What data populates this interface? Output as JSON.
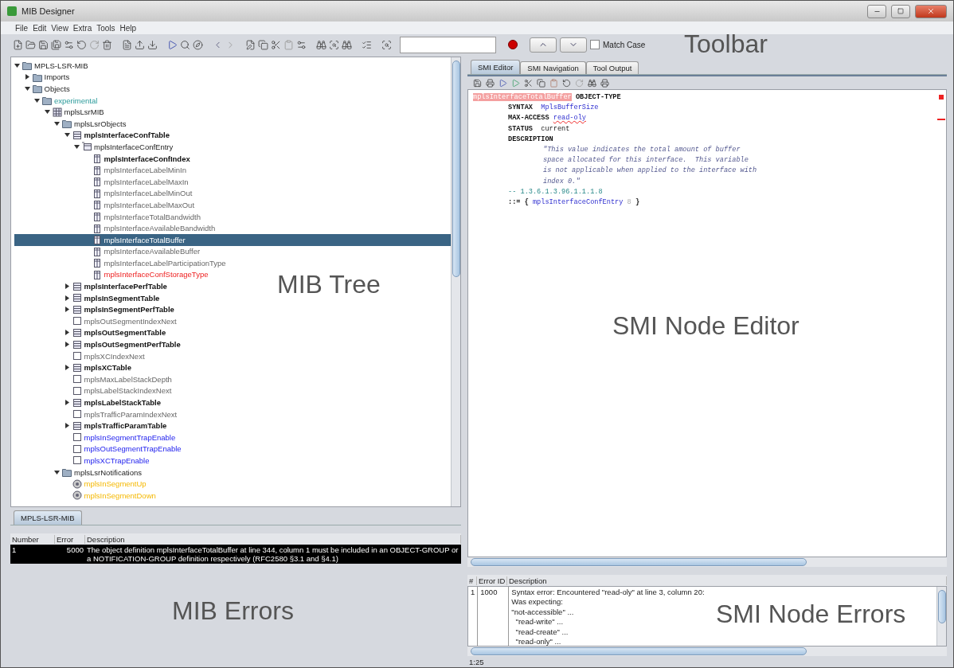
{
  "window": {
    "title": "MIB Designer"
  },
  "menu": [
    "File",
    "Edit",
    "View",
    "Extra",
    "Tools",
    "Help"
  ],
  "toolbar": {
    "match_case": {
      "label": "Match Case",
      "checked": false
    }
  },
  "tree": {
    "nodes": [
      {
        "label": "MPLS-LSR-MIB",
        "kind": "folder",
        "expanded": true,
        "selected": false,
        "children": [
          {
            "label": "Imports",
            "kind": "folder",
            "expanded": false,
            "selected": false
          },
          {
            "label": "Objects",
            "kind": "folder",
            "expanded": true,
            "selected": false,
            "children": [
              {
                "label": "experimental",
                "kind": "branch",
                "expanded": true,
                "selected": false,
                "children": [
                  {
                    "label": "mplsLsrMIB",
                    "kind": "module",
                    "expanded": true,
                    "selected": false,
                    "children": [
                      {
                        "label": "mplsLsrObjects",
                        "kind": "folder",
                        "expanded": true,
                        "selected": false,
                        "children": [
                          {
                            "label": "mplsInterfaceConfTable",
                            "kind": "table",
                            "expanded": true,
                            "selected": false,
                            "children": [
                              {
                                "label": "mplsInterfaceConfEntry",
                                "kind": "entry",
                                "expanded": true,
                                "selected": false,
                                "children": [
                                  {
                                    "label": "mplsInterfaceConfIndex",
                                    "kind": "index",
                                    "selected": false
                                  },
                                  {
                                    "label": "mplsInterfaceLabelMinIn",
                                    "kind": "column",
                                    "selected": false
                                  },
                                  {
                                    "label": "mplsInterfaceLabelMaxIn",
                                    "kind": "column",
                                    "selected": false
                                  },
                                  {
                                    "label": "mplsInterfaceLabelMinOut",
                                    "kind": "column",
                                    "selected": false
                                  },
                                  {
                                    "label": "mplsInterfaceLabelMaxOut",
                                    "kind": "column",
                                    "selected": false
                                  },
                                  {
                                    "label": "mplsInterfaceTotalBandwidth",
                                    "kind": "column",
                                    "selected": false
                                  },
                                  {
                                    "label": "mplsInterfaceAvailableBandwidth",
                                    "kind": "column",
                                    "selected": false
                                  },
                                  {
                                    "label": "mplsInterfaceTotalBuffer",
                                    "kind": "column",
                                    "selected": true
                                  },
                                  {
                                    "label": "mplsInterfaceAvailableBuffer",
                                    "kind": "column",
                                    "selected": false
                                  },
                                  {
                                    "label": "mplsInterfaceLabelParticipationType",
                                    "kind": "column",
                                    "selected": false
                                  },
                                  {
                                    "label": "mplsInterfaceConfStorageType",
                                    "kind": "faulty-column",
                                    "selected": false
                                  }
                                ]
                              }
                            ]
                          },
                          {
                            "label": "mplsInterfacePerfTable",
                            "kind": "table",
                            "expanded": false,
                            "selected": false
                          },
                          {
                            "label": "mplsInSegmentTable",
                            "kind": "table",
                            "expanded": false,
                            "selected": false
                          },
                          {
                            "label": "mplsInSegmentPerfTable",
                            "kind": "table",
                            "expanded": false,
                            "selected": false
                          },
                          {
                            "label": "mplsOutSegmentIndexNext",
                            "kind": "scalar",
                            "selected": false
                          },
                          {
                            "label": "mplsOutSegmentTable",
                            "kind": "table",
                            "expanded": false,
                            "selected": false
                          },
                          {
                            "label": "mplsOutSegmentPerfTable",
                            "kind": "table",
                            "expanded": false,
                            "selected": false
                          },
                          {
                            "label": "mplsXCIndexNext",
                            "kind": "scalar",
                            "selected": false
                          },
                          {
                            "label": "mplsXCTable",
                            "kind": "table",
                            "expanded": false,
                            "selected": false
                          },
                          {
                            "label": "mplsMaxLabelStackDepth",
                            "kind": "scalar",
                            "selected": false
                          },
                          {
                            "label": "mplsLabelStackIndexNext",
                            "kind": "scalar",
                            "selected": false
                          },
                          {
                            "label": "mplsLabelStackTable",
                            "kind": "table",
                            "expanded": false,
                            "selected": false
                          },
                          {
                            "label": "mplsTrafficParamIndexNext",
                            "kind": "scalar",
                            "selected": false
                          },
                          {
                            "label": "mplsTrafficParamTable",
                            "kind": "table",
                            "expanded": false,
                            "selected": false
                          },
                          {
                            "label": "mplsInSegmentTrapEnable",
                            "kind": "writable",
                            "selected": false
                          },
                          {
                            "label": "mplsOutSegmentTrapEnable",
                            "kind": "writable",
                            "selected": false
                          },
                          {
                            "label": "mplsXCTrapEnable",
                            "kind": "writable",
                            "selected": false
                          }
                        ]
                      },
                      {
                        "label": "mplsLsrNotifications",
                        "kind": "folder",
                        "expanded": true,
                        "selected": false,
                        "children": [
                          {
                            "label": "mplsInSegmentUp",
                            "kind": "notification",
                            "selected": false
                          },
                          {
                            "label": "mplsInSegmentDown",
                            "kind": "notification",
                            "selected": false
                          }
                        ]
                      }
                    ]
                  }
                ]
              }
            ]
          }
        ]
      }
    ]
  },
  "module_tabs": [
    {
      "label": "MPLS-LSR-MIB",
      "selected": true
    }
  ],
  "mib_errors": {
    "columns": [
      "Number",
      "Error",
      "Description"
    ],
    "rows": [
      {
        "number": "1",
        "error": "5000",
        "description": "The object definition mplsInterfaceTotalBuffer at line 344, column 1 must be included in an OBJECT-GROUP or a NOTIFICATION-GROUP definition respectively (RFC2580 §3.1 and §4.1)",
        "selected": true
      }
    ]
  },
  "editor_tabs": [
    {
      "label": "SMI Editor",
      "selected": true
    },
    {
      "label": "SMI Navigation",
      "selected": false
    },
    {
      "label": "Tool Output",
      "selected": false
    }
  ],
  "editor": {
    "lines": [
      {
        "kind": "header",
        "segments": [
          {
            "kind": "error-name",
            "text": "mplsInterfaceTotalBuffer"
          },
          {
            "kind": "keyword",
            "text": " OBJECT-TYPE"
          }
        ]
      },
      {
        "kind": "clause",
        "segments": [
          {
            "kind": "keyword",
            "text": "SYNTAX"
          },
          {
            "kind": "type",
            "text": "  MplsBufferSize"
          }
        ]
      },
      {
        "kind": "clause",
        "segments": [
          {
            "kind": "keyword",
            "text": "MAX-ACCESS "
          },
          {
            "kind": "error-link",
            "text": "read-oly"
          }
        ]
      },
      {
        "kind": "clause",
        "segments": [
          {
            "kind": "keyword",
            "text": "STATUS"
          },
          {
            "kind": "plain",
            "text": "  current"
          }
        ]
      },
      {
        "kind": "clause",
        "segments": [
          {
            "kind": "keyword",
            "text": "DESCRIPTION"
          }
        ]
      },
      {
        "kind": "text",
        "segments": [
          {
            "kind": "string",
            "text": "\"This value indicates the total amount of buffer"
          }
        ]
      },
      {
        "kind": "text",
        "segments": [
          {
            "kind": "string",
            "text": "space allocated for this interface.  This variable"
          }
        ]
      },
      {
        "kind": "text",
        "segments": [
          {
            "kind": "string",
            "text": "is not applicable when applied to the interface with"
          }
        ]
      },
      {
        "kind": "text",
        "segments": [
          {
            "kind": "string",
            "text": "index 0.\""
          }
        ]
      },
      {
        "kind": "clause",
        "segments": [
          {
            "kind": "comment",
            "text": "-- 1.3.6.1.3.96.1.1.1.8"
          }
        ]
      },
      {
        "kind": "clause",
        "segments": [
          {
            "kind": "keyword",
            "text": "::= { "
          },
          {
            "kind": "type",
            "text": "mplsInterfaceConfEntry"
          },
          {
            "kind": "faint",
            "text": " 8"
          },
          {
            "kind": "keyword",
            "text": " }"
          }
        ]
      }
    ]
  },
  "smi_errors": {
    "columns": [
      "#",
      "Error ID",
      "Description"
    ],
    "rows": [
      {
        "number": "1",
        "error_id": "1000",
        "description": [
          "Syntax error: Encountered \"read-oly\" at line 3, column 20:",
          "Was expecting:",
          "\"not-accessible\" ...",
          "  \"read-write\" ...",
          "  \"read-create\" ...",
          "  \"read-only\" ..."
        ]
      }
    ]
  },
  "status_bar": {
    "position": "1:25"
  },
  "annotations": [
    "Toolbar",
    "MIB Tree",
    "SMI Node Editor",
    "MIB Errors",
    "SMI Node Errors"
  ]
}
